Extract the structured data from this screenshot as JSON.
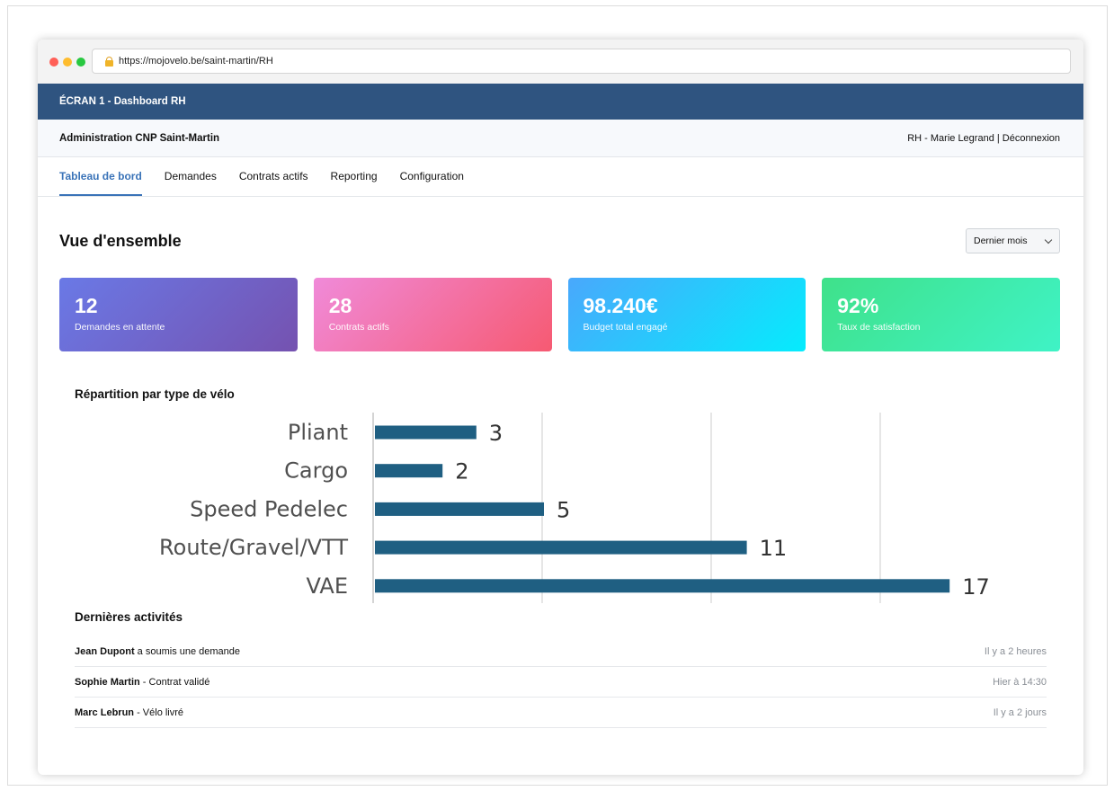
{
  "browser": {
    "url": "https://mojovelo.be/saint-martin/RH"
  },
  "screen_title": "ÉCRAN 1 - Dashboard RH",
  "header": {
    "org": "Administration CNP Saint-Martin",
    "user_info": "RH - Marie Legrand | Déconnexion"
  },
  "nav": {
    "items": [
      {
        "label": "Tableau de bord",
        "active": true
      },
      {
        "label": "Demandes",
        "active": false
      },
      {
        "label": "Contrats actifs",
        "active": false
      },
      {
        "label": "Reporting",
        "active": false
      },
      {
        "label": "Configuration",
        "active": false
      }
    ]
  },
  "overview": {
    "title": "Vue d'ensemble",
    "period": "Dernier mois"
  },
  "stats": [
    {
      "value": "12",
      "label": "Demandes en attente"
    },
    {
      "value": "28",
      "label": "Contrats actifs"
    },
    {
      "value": "98.240€",
      "label": "Budget total engagé"
    },
    {
      "value": "92%",
      "label": "Taux de satisfaction"
    }
  ],
  "chart_data": {
    "type": "bar",
    "orientation": "horizontal",
    "title": "Répartition par type de vélo",
    "categories": [
      "Pliant",
      "Cargo",
      "Speed Pedelec",
      "Route/Gravel/VTT",
      "VAE"
    ],
    "values": [
      3,
      2,
      5,
      11,
      17
    ],
    "xlim": [
      0,
      20
    ],
    "grid": true,
    "data_labels": true,
    "bar_color": "#1f5f82"
  },
  "activities": {
    "title": "Dernières activités",
    "items": [
      {
        "who": "Jean Dupont",
        "what": " a soumis une demande",
        "when": "Il y a 2 heures"
      },
      {
        "who": "Sophie Martin",
        "what": " - Contrat validé",
        "when": "Hier à 14:30"
      },
      {
        "who": "Marc Lebrun",
        "what": " - Vélo livré",
        "when": "Il y a 2 jours"
      }
    ]
  },
  "colors": {
    "title_strip": "#2f5480",
    "accent": "#3a73b8"
  }
}
